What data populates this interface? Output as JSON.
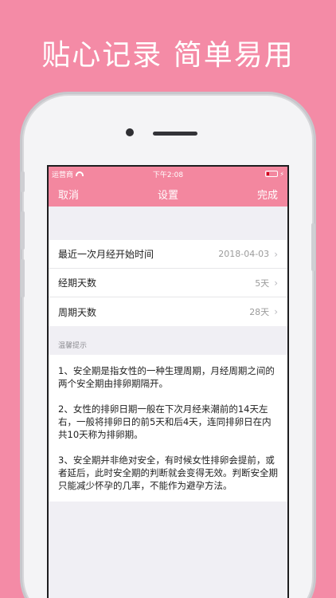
{
  "headline": "贴心记录 简单易用",
  "statusbar": {
    "carrier": "运营商",
    "time": "下午2:08"
  },
  "navbar": {
    "cancel": "取消",
    "title": "设置",
    "done": "完成"
  },
  "settings": [
    {
      "label": "最近一次月经开始时间",
      "value": "2018-04-03"
    },
    {
      "label": "经期天数",
      "value": "5天"
    },
    {
      "label": "周期天数",
      "value": "28天"
    }
  ],
  "tips": {
    "header": "温馨提示",
    "paragraphs": [
      "1、安全期是指女性的一种生理周期，月经周期之间的两个安全期由排卵期隔开。",
      "2、女性的排卵日期一般在下次月经来潮前的14天左右，一般将排卵日的前5天和后4天，连同排卵日在内共10天称为排卵期。",
      "3、安全期并非绝对安全，有时候女性排卵会提前，或者延后，此时安全期的判断就会变得无效。判断安全期只能减少怀孕的几率，不能作为避孕方法。"
    ]
  },
  "icons": [
    "wifi-icon",
    "battery-icon",
    "charging-bolt-icon",
    "chevron-right-icon"
  ],
  "colors": {
    "background": "#F48BA6",
    "navbar": "#F3879F",
    "screen_bg": "#f0eff4"
  }
}
